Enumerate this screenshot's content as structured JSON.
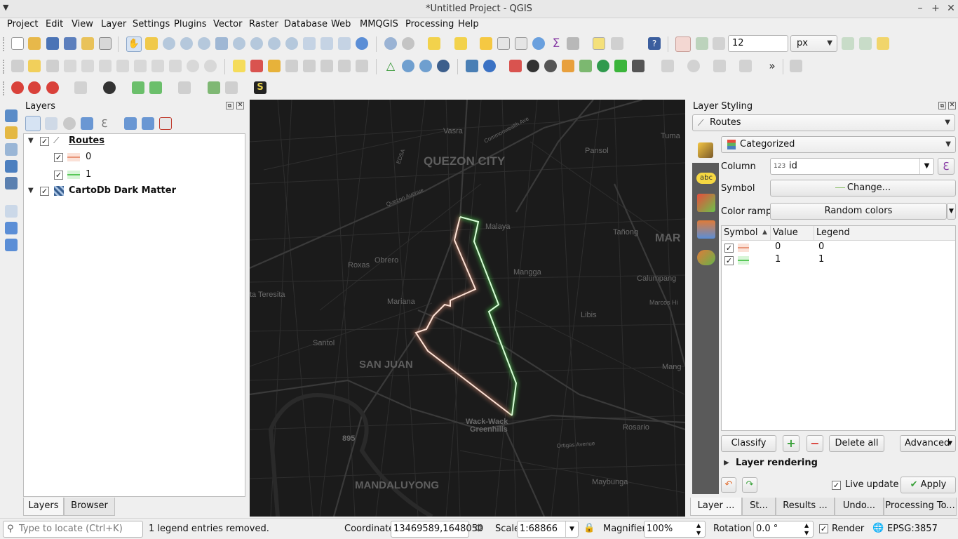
{
  "window": {
    "title": "*Untitled Project - QGIS"
  },
  "menu": [
    "Project",
    "Edit",
    "View",
    "Layer",
    "Settings",
    "Plugins",
    "Vector",
    "Raster",
    "Database",
    "Web",
    "MMQGIS",
    "Processing",
    "Help"
  ],
  "toolbar": {
    "snap_tolerance": "12",
    "snap_units": "px"
  },
  "layers_panel": {
    "title": "Layers",
    "routes_layer": "Routes",
    "route_classes": [
      "0",
      "1"
    ],
    "basemap_layer": "CartoDb Dark Matter",
    "tabs": [
      "Layers",
      "Browser"
    ]
  },
  "map": {
    "labels": {
      "vasra": "Vasra",
      "quezon_city": "QUEZON CITY",
      "pansol": "Pansol",
      "tuma": "Tuma",
      "malaya": "Malaya",
      "tanong": "Tañong",
      "mar": "MAR",
      "roxas": "Roxas",
      "obrero": "Obrero",
      "mangga": "Mangga",
      "calumpang": "Calumpang",
      "marcos_high": "Marcos Hi",
      "sta_teresita": "ta Teresita",
      "mariana": "Mariana",
      "libis": "Libis",
      "santol": "Santol",
      "san_juan": "SAN JUAN",
      "mang": "Mang",
      "wack_wack": "Wack-Wack",
      "greenhills": "Greenhills",
      "rosario": "Rosario",
      "n895": "895",
      "mandaluyong": "MANDALUYONG",
      "maybunga": "Maybunga",
      "edsa": "EDSA",
      "quezon_ave": "Quezon Avenue",
      "commonwealth": "Commonwealth Ave",
      "ortigas": "Ortigas Avenue"
    },
    "route_colors": {
      "route_0": "#f3a58a",
      "route_1": "#5fd35f"
    }
  },
  "styling_panel": {
    "title": "Layer Styling",
    "layer": "Routes",
    "renderer": "Categorized",
    "column_label": "Column",
    "column_value": "id",
    "column_type": "123",
    "symbol_label": "Symbol",
    "symbol_button": "Change...",
    "color_ramp_label": "Color ramp",
    "color_ramp_value": "Random colors",
    "table_headers": [
      "Symbol",
      "Value",
      "Legend"
    ],
    "rows": [
      {
        "value": "0",
        "legend": "0"
      },
      {
        "value": "1",
        "legend": "1"
      }
    ],
    "classify_button": "Classify",
    "delete_all_button": "Delete all",
    "advanced_button": "Advanced",
    "layer_rendering": "Layer rendering",
    "live_update": "Live update",
    "apply_button": "Apply",
    "tabs": [
      "Layer ...",
      "St...",
      "Results ...",
      "Undo...",
      "Processing To..."
    ]
  },
  "statusbar": {
    "locate_placeholder": "Type to locate (Ctrl+K)",
    "message": "1 legend entries removed.",
    "coordinate_label": "Coordinate",
    "coordinate_value": "13469589,1648050",
    "scale_label": "Scale",
    "scale_value": "1:68866",
    "magnifier_label": "Magnifier",
    "magnifier_value": "100%",
    "rotation_label": "Rotation",
    "rotation_value": "0.0 °",
    "render_label": "Render",
    "crs": "EPSG:3857"
  }
}
